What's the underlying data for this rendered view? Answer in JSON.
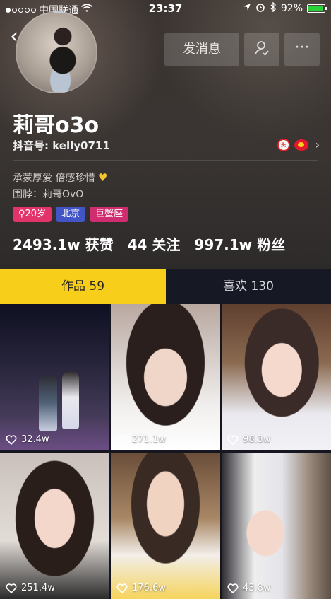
{
  "status_bar": {
    "carrier": "中国联通",
    "time": "23:37",
    "battery": "92%",
    "battery_level": 0.92
  },
  "profile": {
    "nickname": "莉哥o3o",
    "douyin_id": "抖音号: kelly0711",
    "bio": "承蒙厚爱 倍感珍惜",
    "weibo_line": "围脖：莉哥OvO",
    "tags": {
      "age": "♀20岁",
      "city": "北京",
      "zodiac": "巨蟹座"
    },
    "stats": {
      "likes": "2493.1w 获赞",
      "following": "44 关注",
      "followers": "997.1w 粉丝"
    },
    "social_icons": [
      "toutiao-icon",
      "weibo-icon"
    ]
  },
  "actions": {
    "message_label": "发消息",
    "more_label": "···"
  },
  "tabs": {
    "works": "作品 59",
    "likes": "喜欢 130"
  },
  "videos": [
    {
      "likes": "32.4w"
    },
    {
      "likes": "271.1w"
    },
    {
      "likes": "98.3w"
    },
    {
      "likes": "251.4w"
    },
    {
      "likes": "176.6w"
    },
    {
      "likes": "43.8w"
    }
  ],
  "colors": {
    "accent_tab": "#f7ce1a",
    "tag_age": "#e2336b",
    "tag_city": "#4355c6",
    "tag_zodiac": "#cf2d70",
    "battery_green": "#29d23b"
  }
}
